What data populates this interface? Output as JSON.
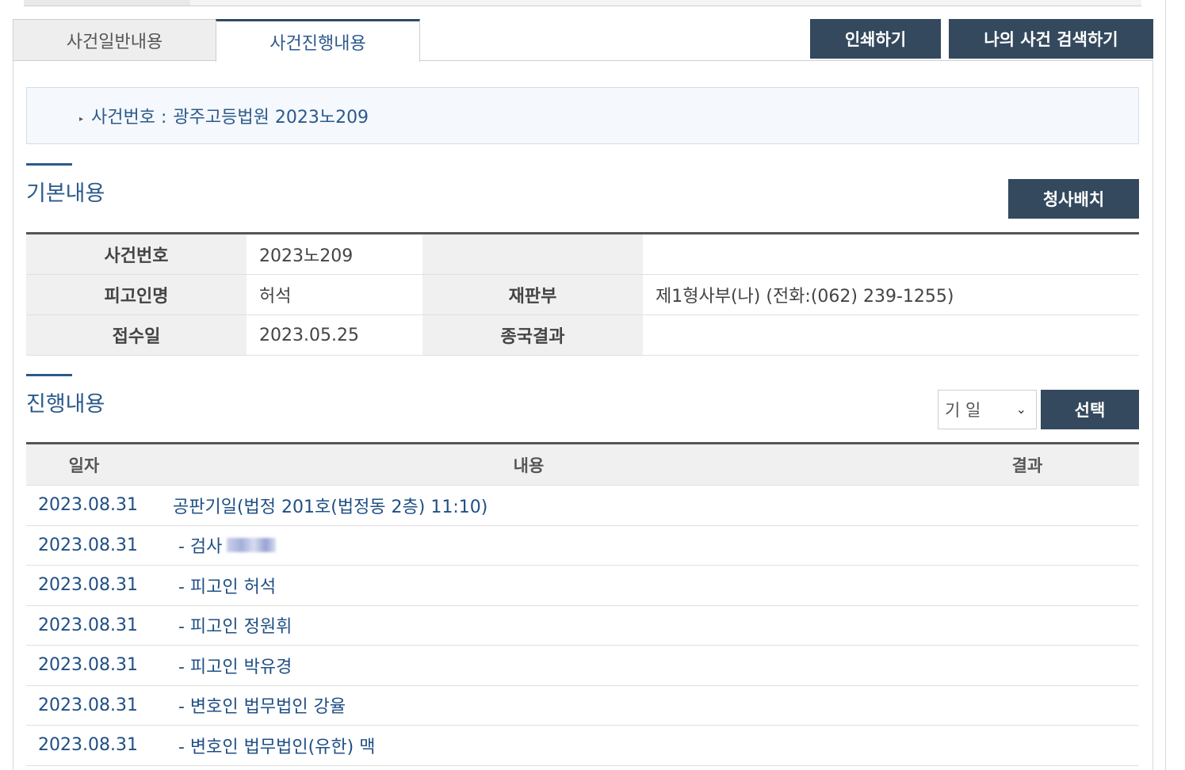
{
  "tabs": {
    "general": "사건일반내용",
    "progress": "사건진행내용"
  },
  "buttons": {
    "print": "인쇄하기",
    "my_search": "나의 사건 검색하기",
    "court_layout": "청사배치",
    "select": "선택"
  },
  "case_header": {
    "label": "사건번호 :",
    "value": "광주고등법원 2023노209"
  },
  "basic": {
    "title": "기본내용",
    "rows": [
      {
        "th1": "사건번호",
        "td1": "2023노209",
        "th2": "",
        "td2": ""
      },
      {
        "th1": "피고인명",
        "td1": "허석",
        "th2": "재판부",
        "td2": "제1형사부(나) (전화:(062) 239-1255)"
      },
      {
        "th1": "접수일",
        "td1": "2023.05.25",
        "th2": "종국결과",
        "td2": ""
      }
    ]
  },
  "progress": {
    "title": "진행내용",
    "filter": {
      "selected": "기 일"
    },
    "headers": {
      "date": "일자",
      "content": "내용",
      "result": "결과"
    },
    "rows": [
      {
        "date": "2023.08.31",
        "content": "공판기일(법정 201호(법정동 2층) 11:10)",
        "result": ""
      },
      {
        "date": "2023.08.31",
        "content": " - 검사",
        "result": ""
      },
      {
        "date": "2023.08.31",
        "content": " - 피고인 허석",
        "result": ""
      },
      {
        "date": "2023.08.31",
        "content": " - 피고인 정원휘",
        "result": ""
      },
      {
        "date": "2023.08.31",
        "content": " - 피고인 박유경",
        "result": ""
      },
      {
        "date": "2023.08.31",
        "content": " - 변호인 법무법인 강율",
        "result": ""
      },
      {
        "date": "2023.08.31",
        "content": " - 변호인 법무법인(유한) 맥",
        "result": ""
      }
    ]
  }
}
